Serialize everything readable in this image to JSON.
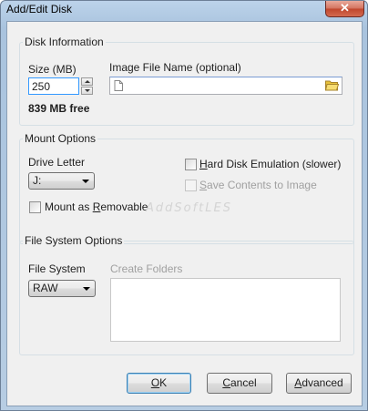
{
  "window": {
    "title": "Add/Edit Disk",
    "close_symbol": "✕"
  },
  "disk_info": {
    "legend": "Disk Information",
    "size_label": "Size (MB)",
    "size_value": "250",
    "free_text": "839 MB free",
    "image_file_label": "Image File Name (optional)",
    "image_file_value": ""
  },
  "mount": {
    "legend": "Mount Options",
    "drive_letter_label": "Drive Letter",
    "drive_letter_value": "J:",
    "removable_label_pre": "Mount as ",
    "removable_label_ul": "R",
    "removable_label_post": "emovable",
    "removable_checked": false,
    "hd_emulation_label_ul": "H",
    "hd_emulation_label_post": "ard Disk Emulation (slower)",
    "hd_emulation_checked": false,
    "save_contents_label_ul": "S",
    "save_contents_label_post": "ave Contents to Image",
    "save_contents_checked": false
  },
  "fs": {
    "legend": "File System Options",
    "fs_label": "File System",
    "fs_value": "RAW",
    "create_folders_label": "Create Folders",
    "create_folders_value": ""
  },
  "buttons": {
    "ok_ul": "O",
    "ok_post": "K",
    "cancel_ul": "C",
    "cancel_post": "ancel",
    "advanced_ul": "A",
    "advanced_post": "dvanced"
  },
  "watermark": "AddSoftLES",
  "icons": {
    "file": "file-icon",
    "folder": "folder-icon"
  },
  "colors": {
    "title_bar": "#b7cde3",
    "close_button": "#c0452c",
    "folder_icon": "#e8c23a"
  }
}
